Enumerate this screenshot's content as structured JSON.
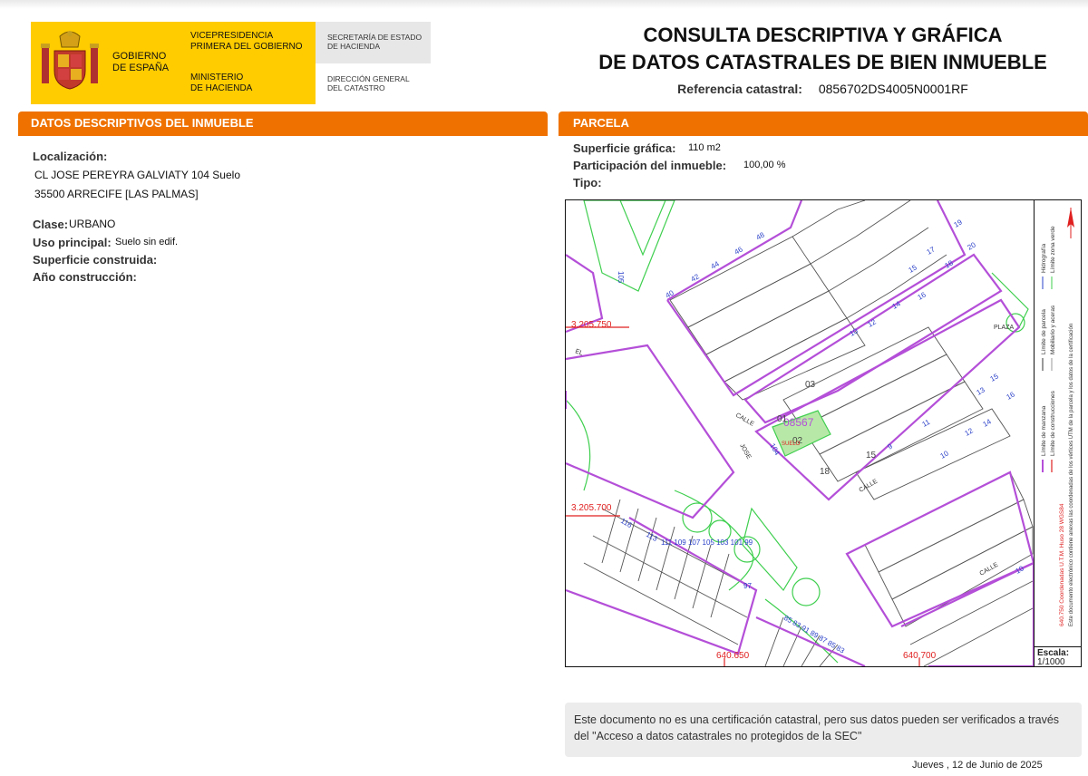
{
  "header": {
    "gobierno": [
      "GOBIERNO",
      "DE ESPAÑA"
    ],
    "vicepresidencia": [
      "VICEPRESIDENCIA",
      "PRIMERA DEL GOBIERNO"
    ],
    "ministerio": [
      "MINISTERIO",
      "DE HACIENDA"
    ],
    "secretaria": [
      "SECRETARÍA DE ESTADO",
      "DE HACIENDA"
    ],
    "direccion": [
      "DIRECCIÓN GENERAL",
      "DEL CATASTRO"
    ],
    "title_line1": "CONSULTA DESCRIPTIVA Y GRÁFICA",
    "title_line2": "DE DATOS CATASTRALES DE BIEN INMUEBLE",
    "ref_label": "Referencia catastral:",
    "ref_value": "0856702DS4005N0001RF",
    "colors": {
      "yellow": "#ffcc00",
      "orange": "#ef7200"
    }
  },
  "left_panel": {
    "title": "DATOS DESCRIPTIVOS DEL INMUEBLE",
    "localizacion_label": "Localización:",
    "localizacion_line1": "CL JOSE PEREYRA GALVIATY 104 Suelo",
    "localizacion_line2": "35500 ARRECIFE [LAS PALMAS]",
    "clase_label": "Clase:",
    "clase_value": "URBANO",
    "uso_label": "Uso principal:",
    "uso_value": "Suelo sin edif.",
    "superficie_label": "Superficie construida:",
    "anio_label": "Año construcción:"
  },
  "right_panel": {
    "title": "PARCELA",
    "sup_label": "Superficie gráfica:",
    "sup_value": "110 m2",
    "part_label": "Participación del inmueble:",
    "part_value": "100,00 %",
    "tipo_label": "Tipo:"
  },
  "map": {
    "coord_labels": [
      "3.205.750",
      "3.205.700",
      "640.650",
      "640.700"
    ],
    "plot_ref": "08567",
    "plot_numbers": [
      "03",
      "01",
      "02",
      "18",
      "15"
    ],
    "street_labels": [
      "CALLE",
      "JOSE",
      "CALLE",
      "CALLE",
      "PLAZA",
      "EL"
    ],
    "suelo_label": "SUELO",
    "legend_lines": [
      "Límite de manzana",
      "Límite de parcela",
      "Hidrografía",
      "Límite de construcciones",
      "Mobiliario y aceras",
      "Límite zona verde",
      "Este documento electrónico contiene anexas las coordenadas de los vértices UTM de la parcela y los datos de la certificación"
    ],
    "coords_note": "640.750 Coordenadas U.T.M. Huso 28 WGS84",
    "scale_label": "Escala:",
    "scale_value": "1/1000",
    "colors": {
      "manzana": "#b44fd8",
      "verde": "#3fcf4f",
      "red": "#e02020",
      "blue": "#2a40c8"
    }
  },
  "notice": "Este documento no es una certificación catastral, pero sus datos pueden ser verificados a través del \"Acceso a datos catastrales no protegidos de la SEC\"",
  "footer_date": "Jueves , 12 de Junio de 2025"
}
